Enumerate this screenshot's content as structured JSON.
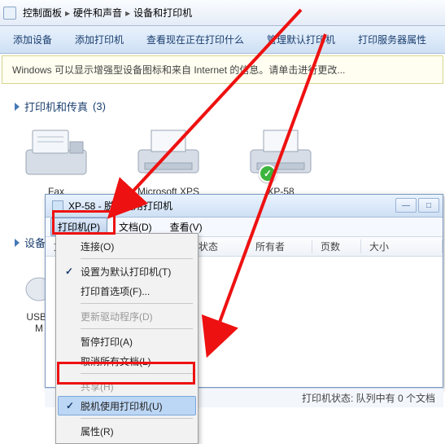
{
  "breadcrumb": {
    "seg1": "控制面板",
    "seg2": "硬件和声音",
    "seg3": "设备和打印机"
  },
  "commands": {
    "add_device": "添加设备",
    "add_printer": "添加打印机",
    "see_printing": "查看现在正在打印什么",
    "manage_default": "管理默认打印机",
    "server_props": "打印服务器属性"
  },
  "infobar": "Windows 可以显示增强型设备图标和来自 Internet 的信息。请单击进行更改...",
  "section1": {
    "title": "打印机和传真",
    "count": "(3)"
  },
  "devices": [
    {
      "name": "Fax",
      "kind": "fax"
    },
    {
      "name": "Microsoft XPS",
      "kind": "printer"
    },
    {
      "name": "XP-58",
      "kind": "printer",
      "default": true
    }
  ],
  "section2": {
    "title": "设备"
  },
  "side_device_label": "USB I\nM",
  "dialog": {
    "title": "XP-58  -  脱机使用打印机",
    "menus": {
      "printer": "打印机(P)",
      "doc": "文档(D)",
      "view": "查看(V)"
    },
    "columns": {
      "name": "文档名",
      "status": "状态",
      "owner": "所有者",
      "pages": "页数",
      "size": "大小"
    },
    "status": "打印机状态: 队列中有 0 个文档"
  },
  "dropdown": {
    "connect": "连接(O)",
    "set_default": "设置为默认打印机(T)",
    "prefs": "打印首选项(F)...",
    "update_driver": "更新驱动程序(D)",
    "pause": "暂停打印(A)",
    "cancel_all": "取消所有文档(L)",
    "share": "共享(H)",
    "offline": "脱机使用打印机(U)",
    "properties": "属性(R)"
  }
}
